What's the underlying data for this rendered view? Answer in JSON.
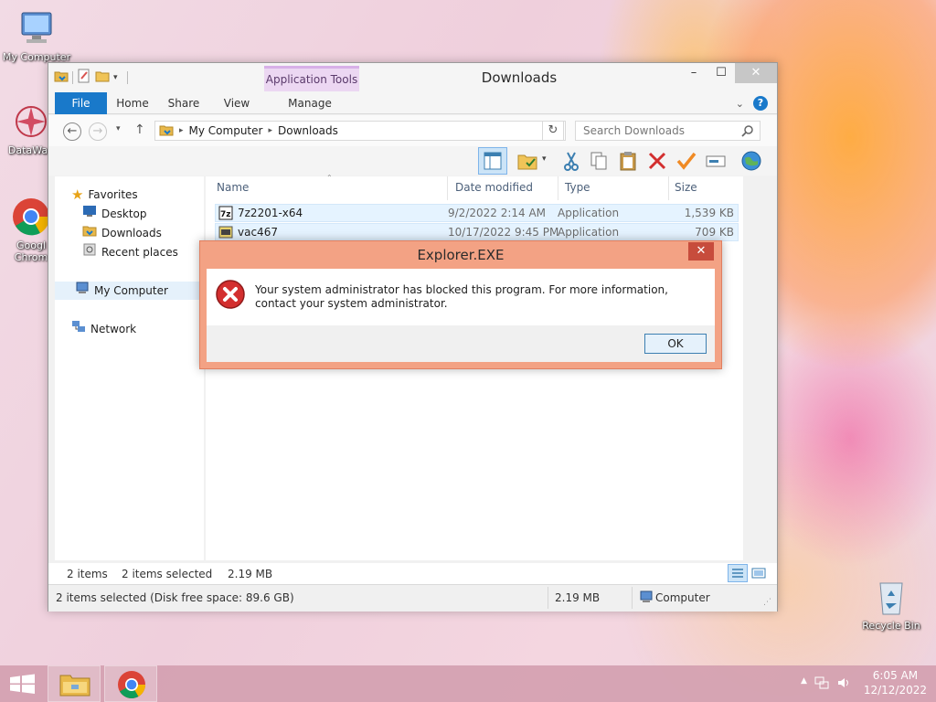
{
  "desktop": {
    "icons": [
      {
        "label": "My Computer"
      },
      {
        "label": "DataWag"
      },
      {
        "label": "Googl\nChrom"
      },
      {
        "label": "Recycle Bin"
      }
    ]
  },
  "explorer": {
    "title": "Downloads",
    "context_tab": "Application Tools",
    "ribbon_tabs": {
      "file": "File",
      "home": "Home",
      "share": "Share",
      "view": "View",
      "manage": "Manage"
    },
    "breadcrumb": [
      "My Computer",
      "Downloads"
    ],
    "search_placeholder": "Search Downloads",
    "nav": {
      "favorites": "Favorites",
      "desktop": "Desktop",
      "downloads": "Downloads",
      "recent": "Recent places",
      "computer": "My Computer",
      "network": "Network"
    },
    "columns": {
      "name": "Name",
      "date": "Date modified",
      "type": "Type",
      "size": "Size"
    },
    "files": [
      {
        "name": "7z2201-x64",
        "date": "9/2/2022 2:14 AM",
        "type": "Application",
        "size": "1,539 KB"
      },
      {
        "name": "vac467",
        "date": "10/17/2022 9:45 PM",
        "type": "Application",
        "size": "709 KB"
      }
    ],
    "status_top": {
      "items": "2 items",
      "selected": "2 items selected",
      "size": "2.19 MB"
    },
    "status_bottom": {
      "selection": "2 items selected (Disk free space: 89.6 GB)",
      "size": "2.19 MB",
      "location": "Computer"
    }
  },
  "dialog": {
    "title": "Explorer.EXE",
    "message": "Your system administrator has blocked this program. For more information, contact your system administrator.",
    "ok": "OK"
  },
  "taskbar": {
    "time": "6:05 AM",
    "date": "12/12/2022"
  },
  "colors": {
    "file_tab": "#1979ca",
    "dialog_frame": "#f3a284",
    "context_tab": "#ecd7f2",
    "error_icon": "#d32f2f"
  }
}
